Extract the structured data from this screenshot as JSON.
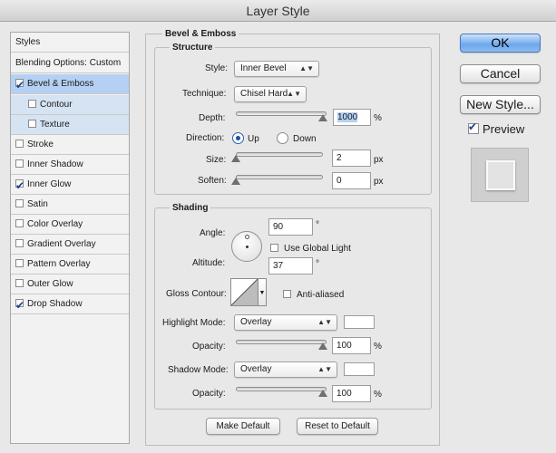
{
  "window": {
    "title": "Layer Style"
  },
  "left_panel": {
    "header": "Styles",
    "blending_options": "Blending Options: Custom",
    "items": [
      {
        "label": "Bevel & Emboss",
        "checked": true,
        "selected": true
      },
      {
        "label": "Contour",
        "checked": false,
        "sub": true
      },
      {
        "label": "Texture",
        "checked": false,
        "sub": true
      },
      {
        "label": "Stroke",
        "checked": false
      },
      {
        "label": "Inner Shadow",
        "checked": false
      },
      {
        "label": "Inner Glow",
        "checked": true
      },
      {
        "label": "Satin",
        "checked": false
      },
      {
        "label": "Color Overlay",
        "checked": false
      },
      {
        "label": "Gradient Overlay",
        "checked": false
      },
      {
        "label": "Pattern Overlay",
        "checked": false
      },
      {
        "label": "Outer Glow",
        "checked": false
      },
      {
        "label": "Drop Shadow",
        "checked": true
      }
    ]
  },
  "bevel": {
    "title": "Bevel & Emboss",
    "structure": {
      "title": "Structure",
      "style_label": "Style:",
      "style_value": "Inner Bevel",
      "technique_label": "Technique:",
      "technique_value": "Chisel Hard",
      "depth_label": "Depth:",
      "depth_value": "1000",
      "depth_unit": "%",
      "depth_level": 1.0,
      "direction_label": "Direction:",
      "direction_up": "Up",
      "direction_down": "Down",
      "direction_selected": "Up",
      "size_label": "Size:",
      "size_value": "2",
      "size_unit": "px",
      "soften_label": "Soften:",
      "soften_value": "0",
      "soften_unit": "px"
    },
    "shading": {
      "title": "Shading",
      "angle_label": "Angle:",
      "angle_value": "90",
      "angle_unit": "°",
      "global_light_label": "Use Global Light",
      "global_light_checked": false,
      "altitude_label": "Altitude:",
      "altitude_value": "37",
      "altitude_unit": "°",
      "gloss_label": "Gloss Contour:",
      "anti_aliased_label": "Anti-aliased",
      "anti_aliased_checked": false,
      "highlight_mode_label": "Highlight Mode:",
      "highlight_mode_value": "Overlay",
      "highlight_color": "#ffffff",
      "highlight_opacity_label": "Opacity:",
      "highlight_opacity_value": "100",
      "shadow_mode_label": "Shadow Mode:",
      "shadow_mode_value": "Overlay",
      "shadow_color": "#ffffff",
      "shadow_opacity_label": "Opacity:",
      "shadow_opacity_value": "100",
      "opacity_unit": "%"
    },
    "make_default": "Make Default",
    "reset_default": "Reset to Default"
  },
  "buttons": {
    "ok": "OK",
    "cancel": "Cancel",
    "new_style": "New Style...",
    "preview_label": "Preview",
    "preview_checked": true
  },
  "colors": {
    "accent": "#6da7ec",
    "selected_row": "#b5d0f2"
  }
}
